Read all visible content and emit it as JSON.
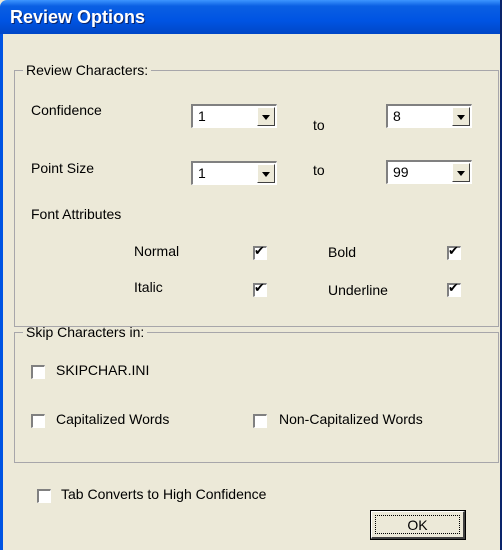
{
  "window": {
    "title": "Review Options"
  },
  "review_characters": {
    "legend": "Review Characters:",
    "confidence": {
      "label": "Confidence",
      "from": "1",
      "to_label": "to",
      "to": "8"
    },
    "point_size": {
      "label": "Point Size",
      "from": "1",
      "to_label": "to",
      "to": "99"
    },
    "font_attributes": {
      "label": "Font Attributes",
      "normal": {
        "label": "Normal",
        "checked": true
      },
      "bold": {
        "label": "Bold",
        "checked": true
      },
      "italic": {
        "label": "Italic",
        "checked": true
      },
      "underline": {
        "label": "Underline",
        "checked": true
      }
    }
  },
  "skip_characters": {
    "legend": "Skip Characters in:",
    "skipchar_ini": {
      "label": "SKIPCHAR.INI",
      "checked": false
    },
    "capitalized": {
      "label": "Capitalized Words",
      "checked": false
    },
    "non_capitalized": {
      "label": "Non-Capitalized Words",
      "checked": false
    }
  },
  "tab_converts": {
    "label": "Tab Converts to High Confidence",
    "checked": false
  },
  "buttons": {
    "ok": "OK"
  },
  "check_glyph": "✔"
}
